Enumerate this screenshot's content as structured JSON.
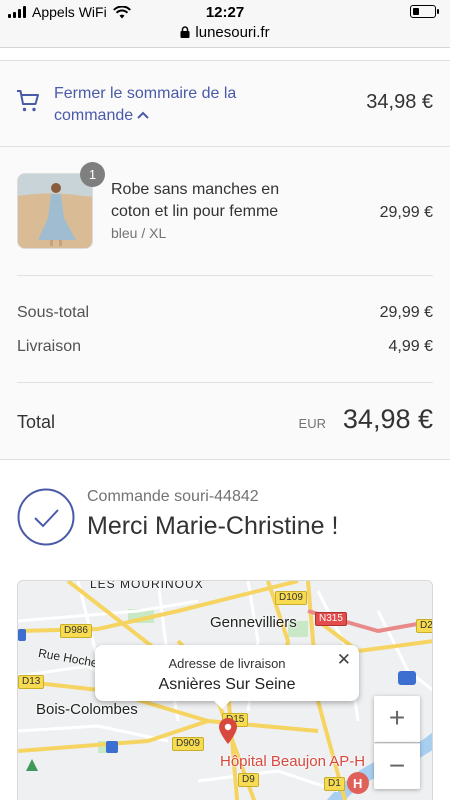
{
  "status_bar": {
    "carrier": "Appels WiFi",
    "time": "12:27"
  },
  "browser": {
    "url": "lunesouri.fr"
  },
  "summary": {
    "toggle_label": "Fermer le sommaire de la commande",
    "total": "34,98 €"
  },
  "product": {
    "quantity": "1",
    "name": "Robe sans manches en coton et lin pour femme",
    "variant": "bleu / XL",
    "price": "29,99 €"
  },
  "costs": {
    "subtotal_label": "Sous-total",
    "subtotal_value": "29,99 €",
    "shipping_label": "Livraison",
    "shipping_value": "4,99 €"
  },
  "total": {
    "label": "Total",
    "currency": "EUR",
    "value": "34,98 €"
  },
  "confirmation": {
    "order_number": "Commande souri-44842",
    "thanks": "Merci Marie-Christine !"
  },
  "map": {
    "popup_title": "Adresse de livraison",
    "popup_value": "Asnières Sur Seine",
    "places": {
      "les_mourinoux": "LES MOURINOUX",
      "gennevilliers": "Gennevilliers",
      "bois_colombes": "Bois-Colombes",
      "rue_hoche": "Rue Hoche",
      "hopital": "Hôpital Beaujon AP-H"
    },
    "roads": {
      "d109": "D109",
      "n315": "N315",
      "d986": "D986",
      "d13": "D13",
      "d15": "D15",
      "d909": "D909",
      "d9": "D9",
      "d1": "D1",
      "d2": "D2"
    },
    "zoom_in": "+",
    "zoom_out": "−"
  },
  "colors": {
    "accent": "#4a5aa8",
    "pin": "#d9483f"
  }
}
